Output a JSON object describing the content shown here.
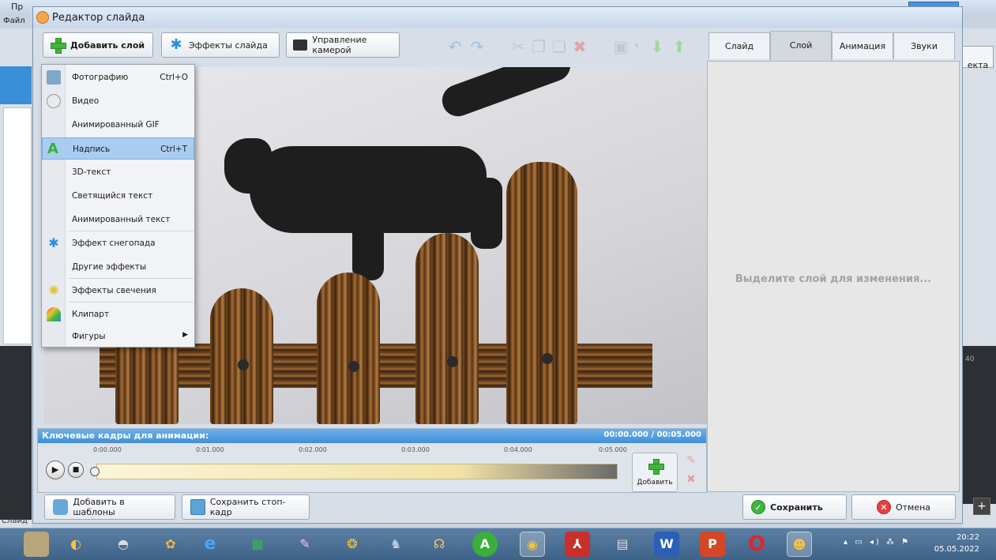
{
  "background_app": {
    "title": "Пр",
    "menu_first": "Файл",
    "right_tab_fragment": "екта",
    "bottom_text_1": "Сла",
    "bottom_text_2": "Слайд",
    "time_fragment": "40"
  },
  "dialog": {
    "title": "Редактор слайда"
  },
  "toolbar": {
    "add_layer": "Добавить слой",
    "slide_effects": "Эффекты слайда",
    "camera_control": "Управление камерой"
  },
  "add_layer_menu": {
    "items": [
      {
        "label": "Фотографию",
        "shortcut": "Ctrl+O",
        "icon": "photo-icon"
      },
      {
        "label": "Видео",
        "shortcut": "",
        "icon": "video-icon"
      },
      {
        "label": "Анимированный GIF",
        "shortcut": "",
        "icon": ""
      },
      {
        "label": "Надпись",
        "shortcut": "Ctrl+T",
        "icon": "text-icon",
        "highlighted": true
      },
      {
        "label": "3D-текст",
        "shortcut": "",
        "icon": ""
      },
      {
        "label": "Светящийся текст",
        "shortcut": "",
        "icon": ""
      },
      {
        "label": "Анимированный текст",
        "shortcut": "",
        "icon": ""
      },
      {
        "label": "Эффект снегопада",
        "shortcut": "",
        "icon": "snowflake-icon"
      },
      {
        "label": "Другие эффекты",
        "shortcut": "",
        "icon": ""
      },
      {
        "label": "Эффекты свечения",
        "shortcut": "",
        "icon": "glow-icon"
      },
      {
        "label": "Клипарт",
        "shortcut": "",
        "icon": "clipart-icon"
      },
      {
        "label": "Фигуры",
        "shortcut": "",
        "icon": "",
        "submenu": true
      }
    ]
  },
  "keyframes": {
    "title": "Ключевые кадры для анимации:",
    "time": "00:00.000 / 00:05.000",
    "ticks": [
      "0:00.000",
      "0:01.000",
      "0:02.000",
      "0:03.000",
      "0:04.000",
      "0:05.000"
    ],
    "add_label": "Добавить"
  },
  "right_panel": {
    "tabs": [
      "Слайд",
      "Слой",
      "Анимация",
      "Звуки"
    ],
    "active_tab": "Слой",
    "hint": "Выделите слой для изменения..."
  },
  "bottom": {
    "add_to_templates": "Добавить в шаблоны",
    "save_frame": "Сохранить стоп-кадр",
    "save": "Сохранить",
    "cancel": "Отмена"
  },
  "taskbar": {
    "clock_time": "20:22",
    "clock_date": "05.05.2022"
  },
  "colors": {
    "accent": "#3f8fd8",
    "highlight": "#a9cdf0",
    "save_green": "#3fb53f",
    "cancel_red": "#e34040"
  }
}
